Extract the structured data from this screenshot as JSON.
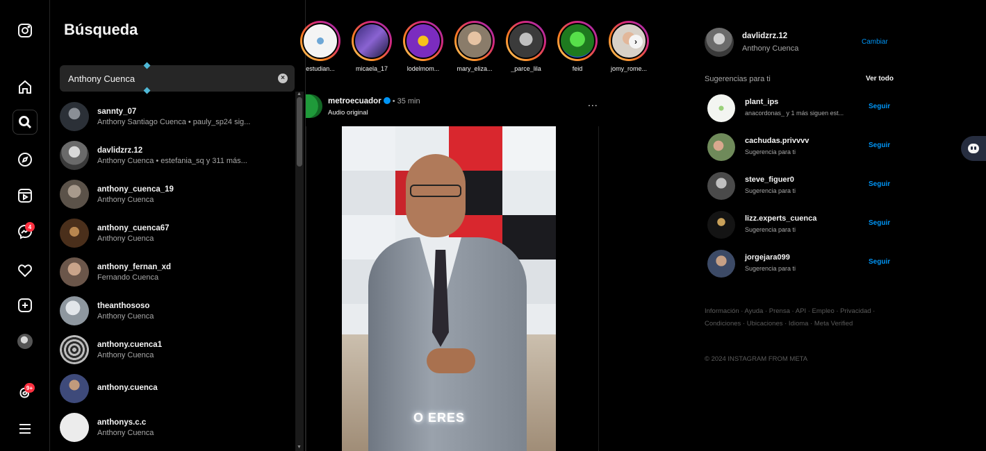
{
  "search_panel": {
    "title": "Búsqueda",
    "query": "Anthony Cuenca",
    "clear_icon": "x-circle-icon",
    "results": [
      {
        "username": "sannty_07",
        "subtitle": "Anthony Santiago Cuenca • pauly_sp24 sig..."
      },
      {
        "username": "davlidzrz.12",
        "subtitle": "Anthony Cuenca • estefania_sq y 311 más..."
      },
      {
        "username": "anthony_cuenca_19",
        "subtitle": "Anthony Cuenca"
      },
      {
        "username": "anthony_cuenca67",
        "subtitle": "Anthony Cuenca"
      },
      {
        "username": "anthony_fernan_xd",
        "subtitle": "Fernando Cuenca"
      },
      {
        "username": "theanthososo",
        "subtitle": "Anthony Cuenca"
      },
      {
        "username": "anthony.cuenca1",
        "subtitle": "Anthony Cuenca"
      },
      {
        "username": "anthony.cuenca",
        "subtitle": ""
      },
      {
        "username": "anthonys.c.c",
        "subtitle": "Anthony Cuenca"
      }
    ]
  },
  "rail": {
    "badges": {
      "messages": "4",
      "threads": "9+"
    }
  },
  "stories": [
    {
      "name": "estudian..."
    },
    {
      "name": "micaela_17"
    },
    {
      "name": "lodelmom..."
    },
    {
      "name": "mary_eliza..."
    },
    {
      "name": "_parce_lila"
    },
    {
      "name": "feid"
    },
    {
      "name": "jomy_rome..."
    }
  ],
  "post": {
    "username": "metroecuador",
    "time": "• 35 min",
    "audio": "Audio original",
    "more": "...",
    "caption_overlay": "O ERES"
  },
  "profile": {
    "username": "davlidzrz.12",
    "name": "Anthony Cuenca",
    "switch": "Cambiar"
  },
  "suggestions": {
    "title": "Sugerencias para ti",
    "see_all": "Ver todo",
    "follow_label": "Seguir",
    "items": [
      {
        "username": "plant_ips",
        "subtitle": "anacordonas_ y 1 más siguen est..."
      },
      {
        "username": "cachudas.privvvv",
        "subtitle": "Sugerencia para ti"
      },
      {
        "username": "steve_figuer0",
        "subtitle": "Sugerencia para ti"
      },
      {
        "username": "lizz.experts_cuenca",
        "subtitle": "Sugerencia para ti"
      },
      {
        "username": "jorgejara099",
        "subtitle": "Sugerencia para ti"
      }
    ]
  },
  "footer": {
    "links": "Información · Ayuda · Prensa · API · Empleo · Privacidad · Condiciones · Ubicaciones · Idioma · Meta Verified",
    "copyright": "© 2024 INSTAGRAM FROM META"
  },
  "colors": {
    "accent": "#0095f6",
    "badge": "#ff3040",
    "background": "#000000"
  }
}
